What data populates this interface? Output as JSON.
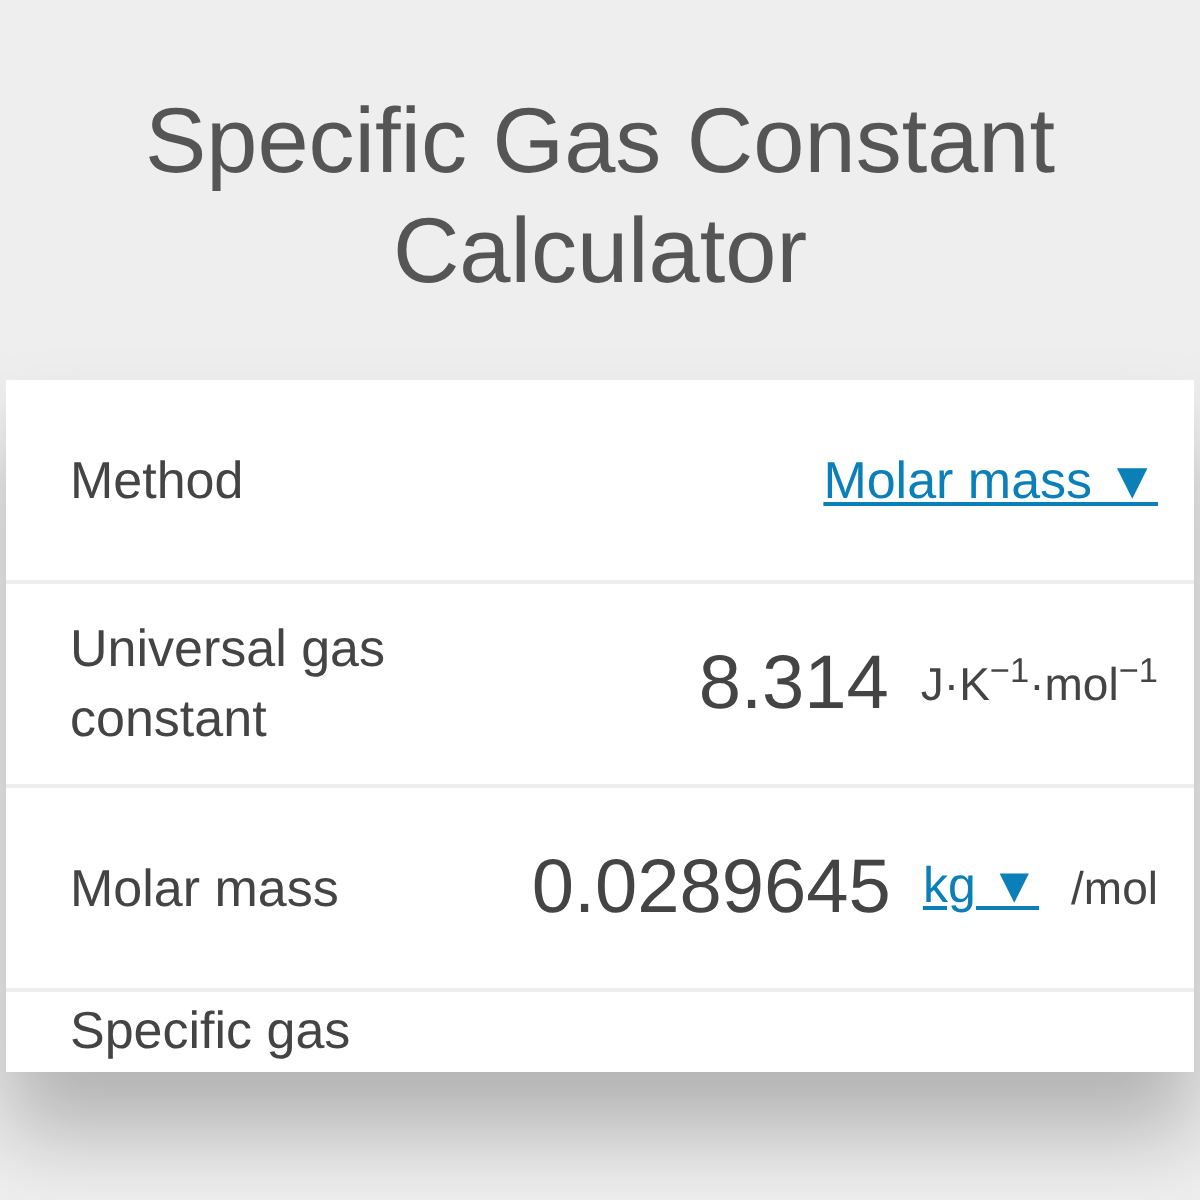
{
  "title": "Specific Gas Constant Calculator",
  "rows": [
    {
      "kind": "select",
      "label": "Method",
      "value": "Molar mass",
      "caret": "▼"
    },
    {
      "kind": "input",
      "label": "Universal gas constant",
      "value": "8.314",
      "unit": "J·K$^{−1}$·mol$^{−1}$"
    },
    {
      "kind": "input",
      "label": "Molar mass",
      "value": "0.0289645",
      "unit_select": "kg",
      "caret": "▼",
      "unit": "/mol"
    },
    {
      "kind": "cut",
      "label": "Specific gas"
    }
  ]
}
